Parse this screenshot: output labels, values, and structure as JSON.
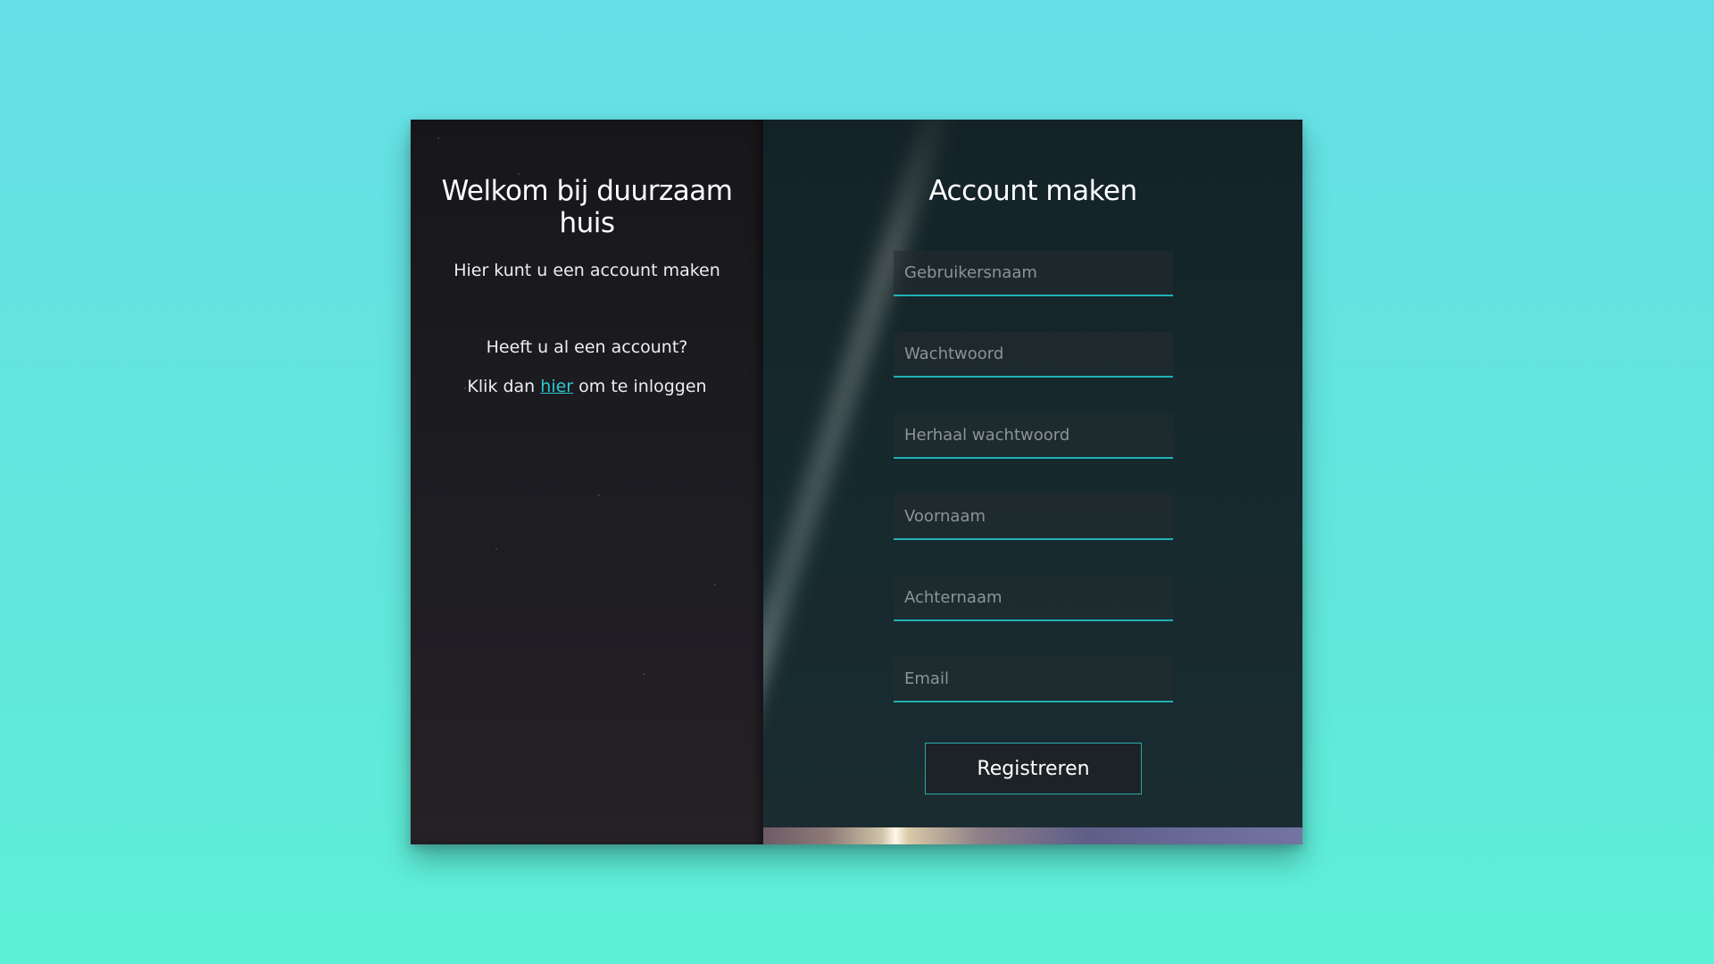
{
  "left": {
    "title": "Welkom bij duurzaam huis",
    "subtitle": "Hier kunt u een account maken",
    "have_account": "Heeft u al een account?",
    "login_prefix": "Klik dan ",
    "login_link": "hier",
    "login_suffix": " om te inloggen"
  },
  "form": {
    "title": "Account maken",
    "fields": [
      {
        "placeholder": "Gebruikersnaam",
        "value": ""
      },
      {
        "placeholder": "Wachtwoord",
        "value": ""
      },
      {
        "placeholder": "Herhaal wachtwoord",
        "value": ""
      },
      {
        "placeholder": "Voornaam",
        "value": ""
      },
      {
        "placeholder": "Achternaam",
        "value": ""
      },
      {
        "placeholder": "Email",
        "value": ""
      }
    ],
    "submit_label": "Registreren"
  },
  "colors": {
    "accent": "#1fb2b6",
    "link": "#2ec9d0",
    "page_background": "#62e2df"
  }
}
